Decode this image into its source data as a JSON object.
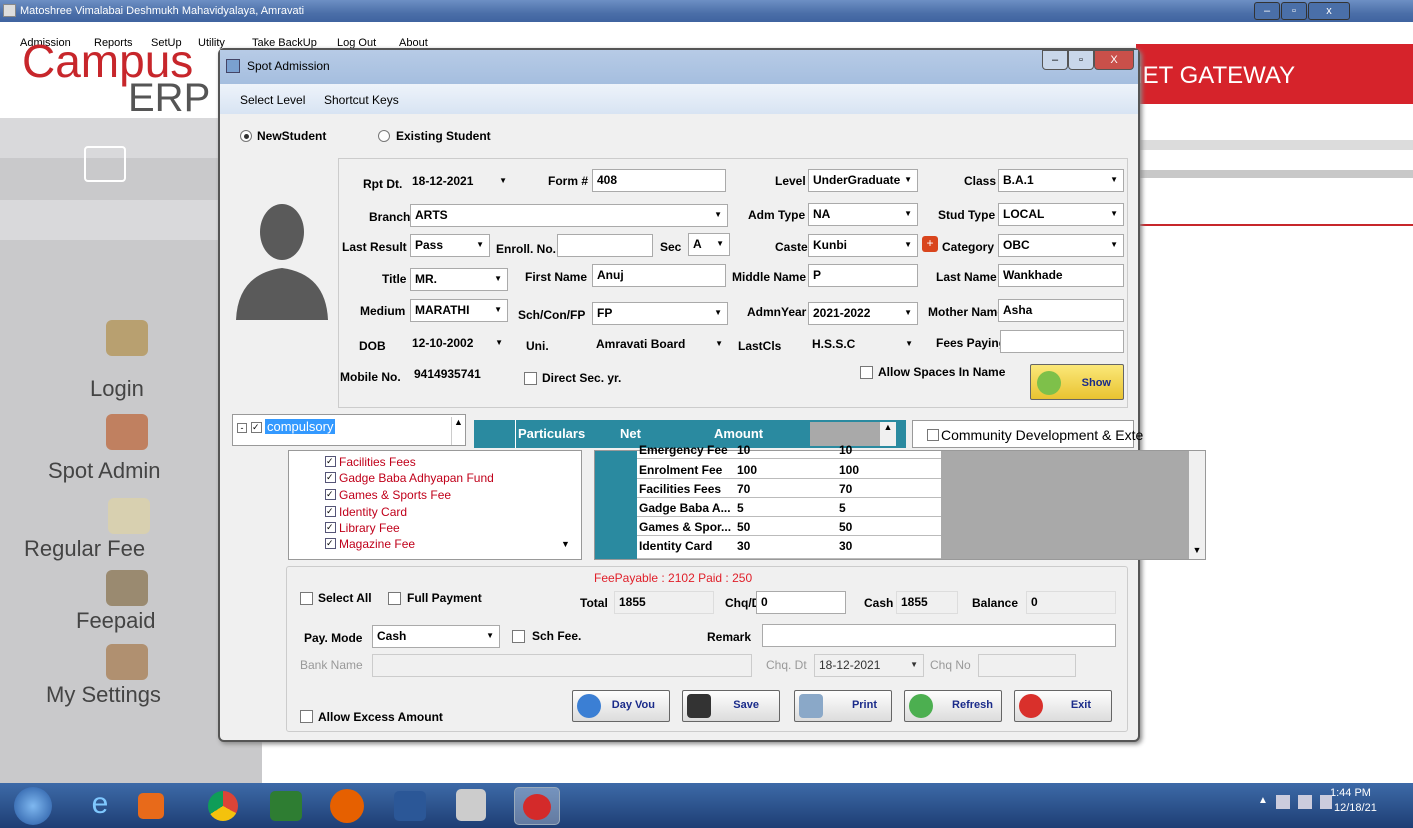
{
  "outer": {
    "title": "Matoshree Vimalabai Deshmukh Mahavidyalaya, Amravati",
    "menu": [
      "Admission",
      "Reports",
      "SetUp",
      "Utility",
      "Take BackUp",
      "Log Out",
      "About"
    ]
  },
  "background": {
    "logo_campus": "Campus",
    "logo_erp": "ERP",
    "gateway": "IET GATEWAY",
    "sidebar": [
      "Login",
      "Spot Admin",
      "Regular Fee",
      "Feepaid",
      "My Settings"
    ]
  },
  "dialog": {
    "title": "Spot Admission",
    "menu": [
      "Select Level",
      "Shortcut Keys"
    ],
    "radio_new": "NewStudent",
    "radio_existing": "Existing Student"
  },
  "form": {
    "rpt_dt_label": "Rpt Dt.",
    "rpt_dt": "18-12-2021",
    "form_label": "Form #",
    "form_no": "408",
    "level_label": "Level",
    "level": "UnderGraduate",
    "class_label": "Class",
    "class": "B.A.1",
    "branch_label": "Branch",
    "branch": "ARTS",
    "adm_type_label": "Adm Type",
    "adm_type": "NA",
    "stud_type_label": "Stud Type",
    "stud_type": "LOCAL",
    "last_result_label": "Last Result",
    "last_result": "Pass",
    "enroll_label": "Enroll. No.",
    "enroll": "",
    "sec_label": "Sec",
    "sec": "A",
    "caste_label": "Caste",
    "caste": "Kunbi",
    "category_label": "Category",
    "category": "OBC",
    "title_label": "Title",
    "title": "MR.",
    "first_name_label": "First Name",
    "first_name": "Anuj",
    "middle_name_label": "Middle Name",
    "middle_name": "P",
    "last_name_label": "Last Name",
    "last_name": "Wankhade",
    "medium_label": "Medium",
    "medium": "MARATHI",
    "schcon_label": "Sch/Con/FP",
    "schcon": "FP",
    "admn_year_label": "AdmnYear",
    "admn_year": "2021-2022",
    "mother_label": "Mother Name",
    "mother": "Asha",
    "dob_label": "DOB",
    "dob": "12-10-2002",
    "uni_label": "Uni.",
    "uni": "Amravati Board",
    "lastcls_label": "LastCls",
    "lastcls": "H.S.S.C",
    "fees_paying_label": "Fees Paying",
    "fees_paying": "",
    "mobile_label": "Mobile No.",
    "mobile": "9414935741",
    "direct_sec": "Direct Sec. yr.",
    "allow_spaces": "Allow Spaces In Name",
    "show": "Show"
  },
  "tree": {
    "root": "compulsory",
    "items": [
      "Facilities Fees",
      "Gadge Baba Adhyapan Fund",
      "Games & Sports Fee",
      "Identity Card",
      "Library Fee",
      "Magazine Fee"
    ]
  },
  "grid": {
    "headers": [
      "Particulars",
      "Net",
      "Amount"
    ],
    "rows": [
      [
        "Emergency Fee",
        "10",
        "10"
      ],
      [
        "Enrolment Fee",
        "100",
        "100"
      ],
      [
        "Facilities Fees",
        "70",
        "70"
      ],
      [
        "Gadge Baba A...",
        "5",
        "5"
      ],
      [
        "Games & Spor...",
        "50",
        "50"
      ],
      [
        "Identity Card",
        "30",
        "30"
      ]
    ]
  },
  "right_tree": {
    "items": [
      "Community Development & Exte"
    ]
  },
  "payment": {
    "fee_payable": "FeePayable : 2102  Paid : 250",
    "select_all": "Select All",
    "full_payment": "Full Payment",
    "total_label": "Total",
    "total": "1855",
    "chq_label": "Chq/DD",
    "chq": "0",
    "cash_label": "Cash",
    "cash": "1855",
    "balance_label": "Balance",
    "balance": "0",
    "pay_mode_label": "Pay. Mode",
    "pay_mode": "Cash",
    "sch_fee": "Sch Fee.",
    "remark_label": "Remark",
    "remark": "",
    "bank_label": "Bank Name",
    "bank": "",
    "chq_dt_label": "Chq. Dt",
    "chq_dt": "18-12-2021",
    "chq_no_label": "Chq No",
    "chq_no": "",
    "allow_excess": "Allow Excess Amount"
  },
  "buttons": {
    "dayvou": "Day Vou",
    "save": "Save",
    "print": "Print",
    "refresh": "Refresh",
    "exit": "Exit"
  },
  "taskbar": {
    "time": "1:44 PM",
    "date": "12/18/21"
  }
}
